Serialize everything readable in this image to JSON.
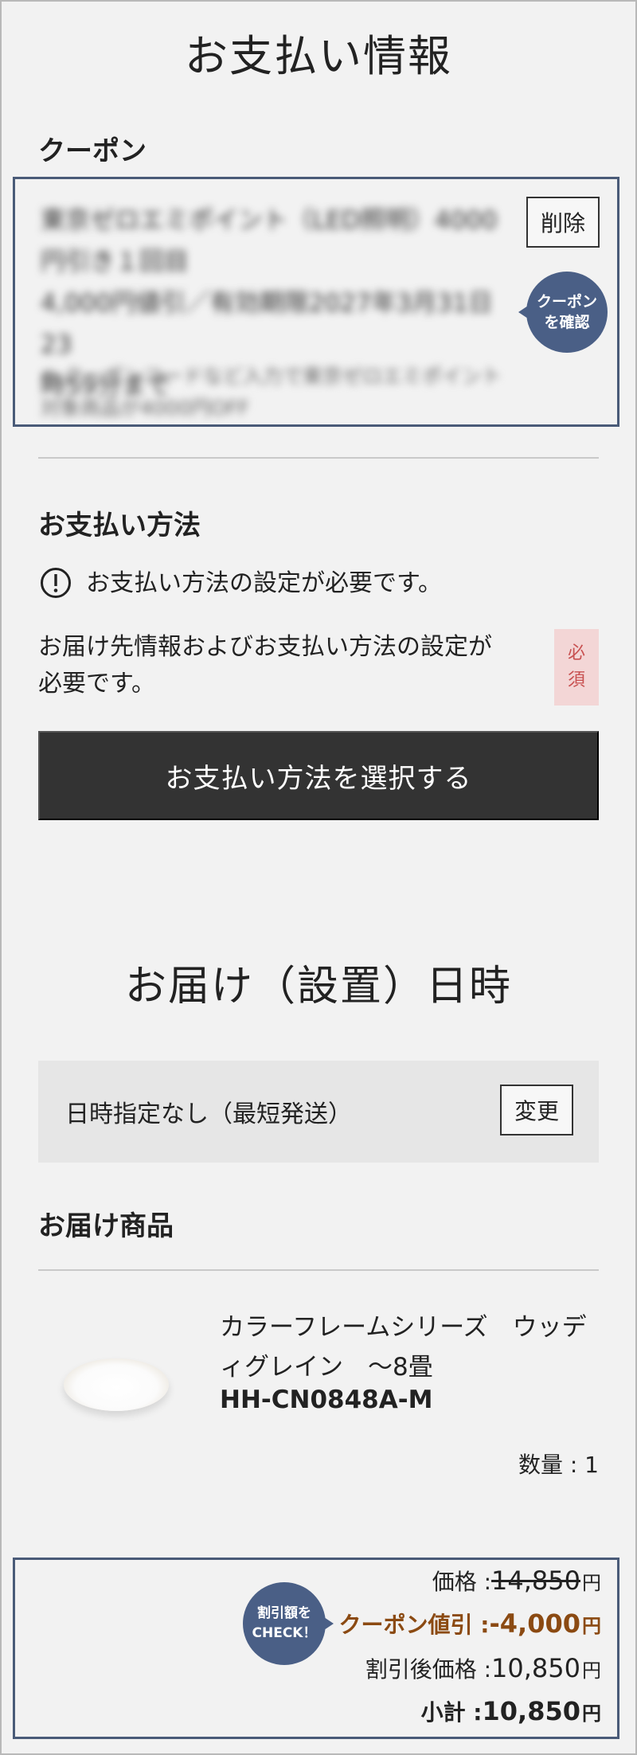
{
  "page_title": "お支払い情報",
  "coupon": {
    "heading": "クーポン",
    "name_lines": [
      "東京ゼロエミポイント（LED照明）4000",
      "円引き１回目",
      "4,000円値引／有効期限2027年3月31日 23",
      "時59分まで"
    ],
    "note_lines": [
      "※ クーポンコードなど入力で東京ゼロエミポイント",
      "対象商品が4000円OFF"
    ],
    "delete_label": "削除",
    "check_badge_lines": [
      "クーポン",
      "を確認"
    ]
  },
  "payment": {
    "heading": "お支払い方法",
    "alert_icon": "exclamation-circle-icon",
    "alert_text": "お支払い方法の設定が必要です。",
    "info_lines": [
      "お届け先情報およびお支払い方法の設定が",
      "必要です。"
    ],
    "required_lines": [
      "必",
      "須"
    ],
    "select_button": "お支払い方法を選択する"
  },
  "delivery": {
    "heading": "お届け（設置）日時",
    "date_text": "日時指定なし（最短発送）",
    "change_label": "変更"
  },
  "items": {
    "heading": "お届け商品",
    "product": {
      "name_lines": [
        "カラーフレームシリーズ　ウッデ",
        "ィグレイン　～8畳"
      ],
      "model": "HH-CN0848A-M",
      "quantity": "数量 : 1"
    }
  },
  "summary": {
    "badge_lines": [
      "割引額を",
      "CHECK！"
    ],
    "price_label": "価格 : ",
    "price_value": "14,850",
    "coupon_label": "クーポン値引 : ",
    "coupon_value": "-4,000",
    "after_label": "割引後価格 : ",
    "after_value": "10,850",
    "subtotal_label": "小計 : ",
    "subtotal_value": "10,850",
    "yen": "円"
  },
  "colors": {
    "navy": "#4a5b78",
    "badge": "#4a5f86",
    "dark_button": "#333333",
    "coupon_discount": "#8b4a12",
    "required_bg": "#f3d6d6"
  }
}
